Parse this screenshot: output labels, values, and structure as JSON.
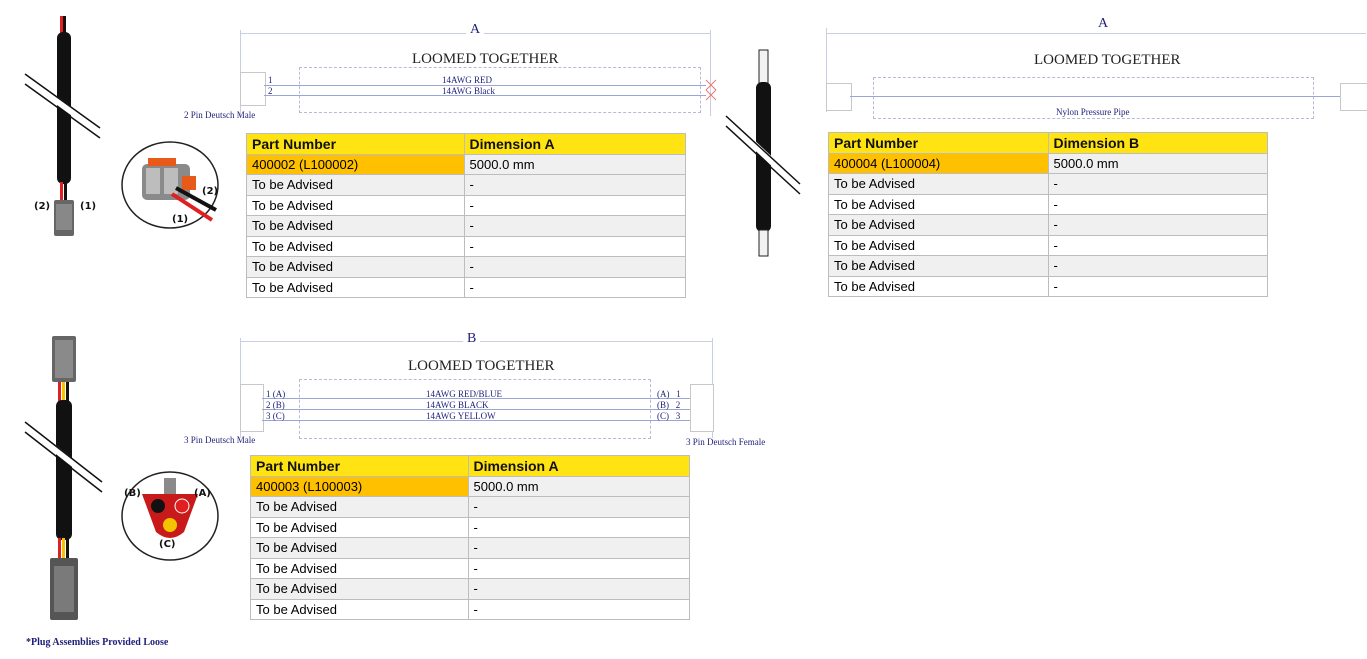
{
  "assemblies": [
    {
      "dimension_letter": "A",
      "loom_label": "LOOMED TOGETHER",
      "left_connector": "2 Pin Deutsch Male",
      "wires": [
        {
          "pin": "1",
          "label": "14AWG RED"
        },
        {
          "pin": "2",
          "label": "14AWG Black"
        }
      ],
      "cable_pin_labels": [
        "(2)",
        "(1)"
      ],
      "connector_pin_labels": [
        "(2)",
        "(1)"
      ],
      "table": {
        "headers": [
          "Part Number",
          "Dimension A"
        ],
        "rows": [
          [
            "400002 (L100002)",
            "5000.0 mm"
          ],
          [
            "To be Advised",
            "-"
          ],
          [
            "To be Advised",
            "-"
          ],
          [
            "To be Advised",
            "-"
          ],
          [
            "To be Advised",
            "-"
          ],
          [
            "To be Advised",
            "-"
          ],
          [
            "To be Advised",
            "-"
          ]
        ]
      }
    },
    {
      "dimension_letter": "A",
      "loom_label": "LOOMED TOGETHER",
      "pipe_label": "Nylon Pressure Pipe",
      "table": {
        "headers": [
          "Part Number",
          "Dimension B"
        ],
        "rows": [
          [
            "400004 (L100004)",
            "5000.0 mm"
          ],
          [
            "To be Advised",
            "-"
          ],
          [
            "To be Advised",
            "-"
          ],
          [
            "To be Advised",
            "-"
          ],
          [
            "To be Advised",
            "-"
          ],
          [
            "To be Advised",
            "-"
          ],
          [
            "To be Advised",
            "-"
          ]
        ]
      }
    },
    {
      "dimension_letter": "B",
      "loom_label": "LOOMED TOGETHER",
      "left_connector": "3 Pin Deutsch Male",
      "right_connector": "3 Pin Deutsch Female",
      "wires": [
        {
          "pin": "1 (A)",
          "label": "14AWG RED/BLUE",
          "right_pin": "(A)   1"
        },
        {
          "pin": "2 (B)",
          "label": "14AWG BLACK",
          "right_pin": "(B)   2"
        },
        {
          "pin": "3 (C)",
          "label": "14AWG YELLOW",
          "right_pin": "(C)   3"
        }
      ],
      "connector_pin_labels": [
        "(B)",
        "(A)",
        "(C)"
      ],
      "table": {
        "headers": [
          "Part Number",
          "Dimension A"
        ],
        "rows": [
          [
            "400003 (L100003)",
            "5000.0 mm"
          ],
          [
            "To be Advised",
            "-"
          ],
          [
            "To be Advised",
            "-"
          ],
          [
            "To be Advised",
            "-"
          ],
          [
            "To be Advised",
            "-"
          ],
          [
            "To be Advised",
            "-"
          ],
          [
            "To be Advised",
            "-"
          ]
        ]
      }
    }
  ],
  "footnote": "*Plug Assemblies Provided Loose",
  "colors": {
    "header_yellow": "#ffe313",
    "highlight_orange": "#ffc000",
    "wire_red": "#e02020",
    "wire_yellow": "#f5c400",
    "diagram_blue": "#1f1f7a"
  }
}
